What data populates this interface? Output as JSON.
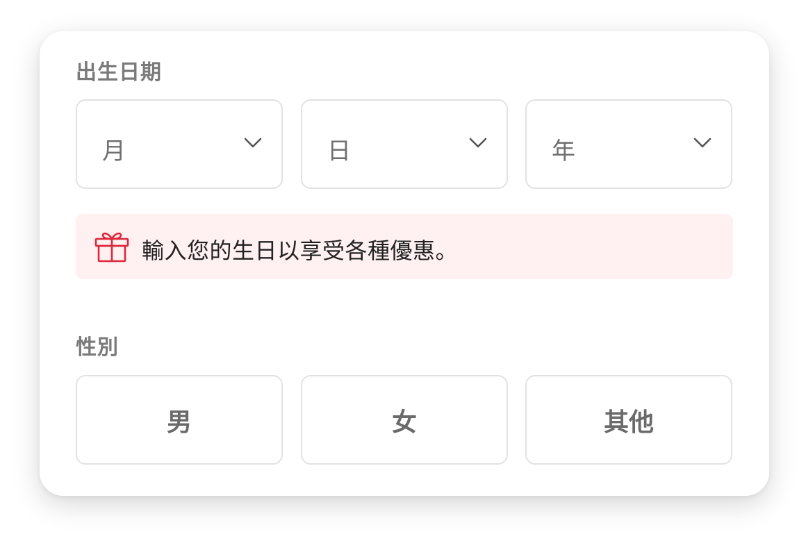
{
  "birthdate": {
    "label": "出生日期",
    "month": {
      "value": "月"
    },
    "day": {
      "value": "日"
    },
    "year": {
      "value": "年"
    }
  },
  "banner": {
    "icon": "gift-icon",
    "message": "輸入您的生日以享受各種優惠。",
    "accent_color": "#e0263a",
    "background_color": "#fff1f2"
  },
  "gender": {
    "label": "性別",
    "options": [
      "男",
      "女",
      "其他"
    ]
  }
}
